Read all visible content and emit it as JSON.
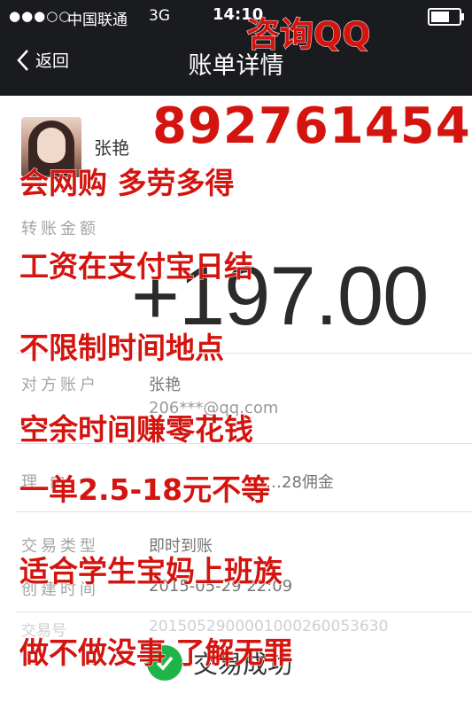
{
  "status": {
    "signal": "●●●○○",
    "carrier": "中国联通",
    "network": "3G",
    "time": "14:10"
  },
  "nav": {
    "back": "返回",
    "title": "账单详情"
  },
  "user": {
    "name": "张艳"
  },
  "transfer": {
    "label": "转账金额",
    "amount": "+197.00"
  },
  "counterparty": {
    "label": "对方账户",
    "name": "张艳",
    "account": "206***@qq.com"
  },
  "reason": {
    "label": "理   由",
    "value": "…28佣金"
  },
  "trade": {
    "type_label": "交易类型",
    "type_value": "即时到账",
    "created_label": "创建时间",
    "created_value": "2015-05-29 22:09",
    "no_label": "交易号",
    "no_value": "2015052900001000260053630"
  },
  "result": {
    "text": "交易成功"
  },
  "ads": {
    "qq": "咨询QQ",
    "qq_number": "892761454",
    "lines": [
      "会网购 多劳多得",
      "工资在支付宝日结",
      "不限制时间地点",
      "空余时间赚零花钱",
      "一单2.5-18元不等",
      "适合学生宝妈上班族",
      "做不做没事 了解无罪"
    ]
  },
  "colors": {
    "header": "#1a1b1f",
    "ad_red": "#d3140f",
    "success_green": "#1fb44a"
  }
}
